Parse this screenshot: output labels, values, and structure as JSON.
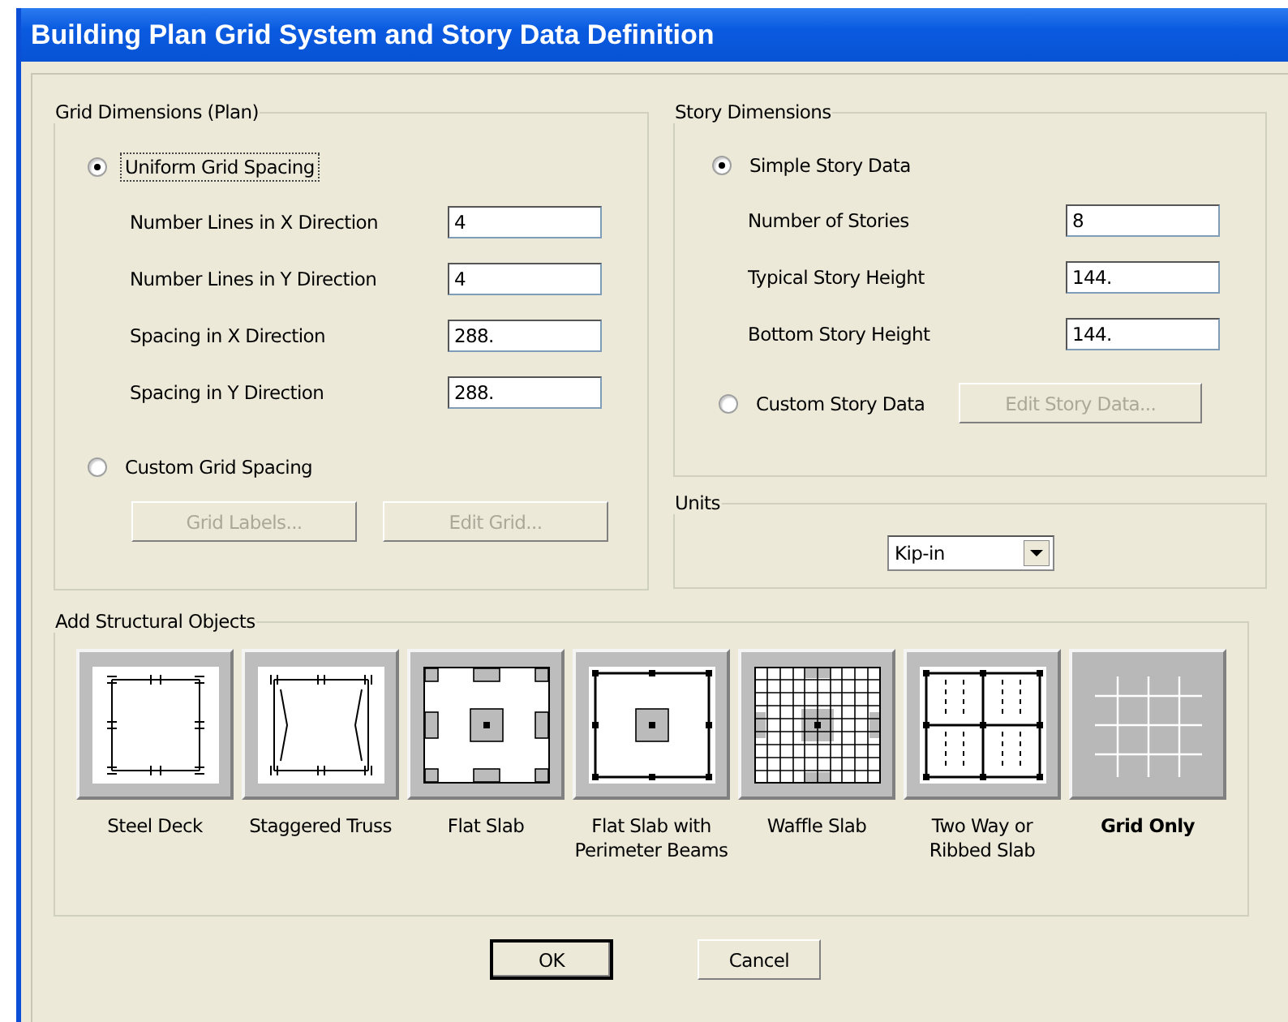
{
  "window": {
    "title": "Building Plan Grid System and Story Data Definition"
  },
  "grid_dimensions": {
    "title": "Grid Dimensions (Plan)",
    "uniform": {
      "label": "Uniform Grid Spacing",
      "selected": true,
      "focused": true
    },
    "fields": [
      {
        "label": "Number Lines in X Direction",
        "value": "4"
      },
      {
        "label": "Number Lines in Y Direction",
        "value": "4"
      },
      {
        "label": "Spacing in X Direction",
        "value": "288."
      },
      {
        "label": "Spacing in Y Direction",
        "value": "288."
      }
    ],
    "custom": {
      "label": "Custom Grid Spacing",
      "selected": false,
      "focused": false
    },
    "buttons": [
      {
        "label": "Grid Labels...",
        "disabled": true
      },
      {
        "label": "Edit Grid...",
        "disabled": true
      }
    ]
  },
  "story_dimensions": {
    "title": "Story Dimensions",
    "simple": {
      "label": "Simple Story Data",
      "selected": true,
      "focused": false
    },
    "fields": [
      {
        "label": "Number of Stories",
        "value": "8"
      },
      {
        "label": "Typical Story Height",
        "value": "144."
      },
      {
        "label": "Bottom Story Height",
        "value": "144."
      }
    ],
    "custom": {
      "label": "Custom Story Data",
      "selected": false,
      "focused": false
    },
    "button": {
      "label": "Edit Story Data...",
      "disabled": true
    }
  },
  "units": {
    "title": "Units",
    "value": "Kip-in"
  },
  "structural_objects": {
    "title": "Add Structural Objects",
    "items": [
      {
        "kind": "steel",
        "label": "Steel Deck",
        "selected": false
      },
      {
        "kind": "truss",
        "label": "Staggered Truss",
        "selected": false
      },
      {
        "kind": "flat",
        "label": "Flat Slab",
        "selected": false
      },
      {
        "kind": "perimeter",
        "label": "Flat Slab with Perimeter Beams",
        "selected": false
      },
      {
        "kind": "waffle",
        "label": "Waffle Slab",
        "selected": false
      },
      {
        "kind": "ribbed",
        "label": "Two Way or Ribbed Slab",
        "selected": false
      },
      {
        "kind": "grid",
        "label": "Grid Only",
        "selected": true
      }
    ]
  },
  "buttons": [
    {
      "label": "OK",
      "default": true
    },
    {
      "label": "Cancel",
      "default": false
    }
  ]
}
